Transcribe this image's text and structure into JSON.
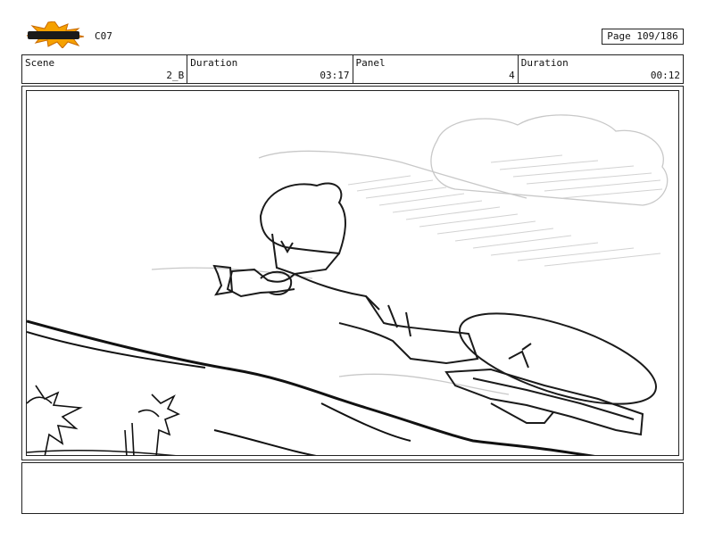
{
  "header": {
    "logo_text": "TOONBOOM",
    "code": "C07",
    "page_label": "Page 109/186"
  },
  "info": [
    {
      "label": "Scene",
      "value": "2_B"
    },
    {
      "label": "Duration",
      "value": "03:17"
    },
    {
      "label": "Panel",
      "value": "4"
    },
    {
      "label": "Duration",
      "value": "00:12"
    }
  ],
  "panel_image": {
    "description_icon": "storyboard-sketch-icon"
  },
  "notes": {
    "text": ""
  }
}
